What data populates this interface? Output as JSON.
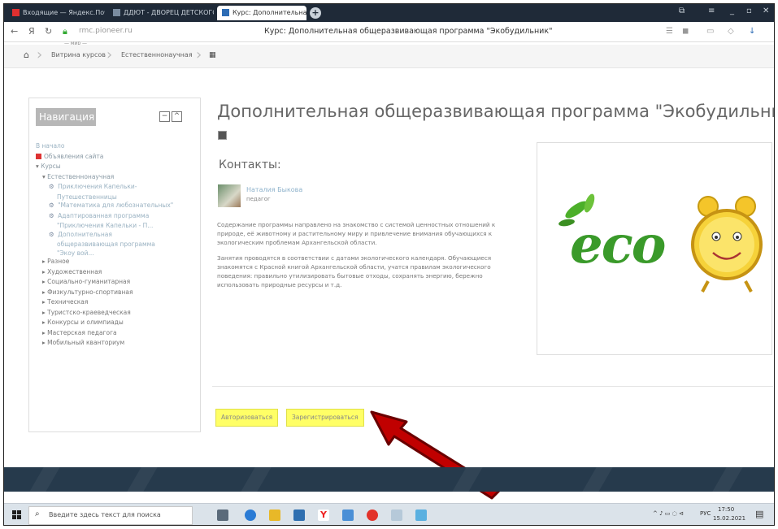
{
  "browser": {
    "tabs": [
      {
        "label": "Входящие — Яндекс.Почта",
        "active": false
      },
      {
        "label": "ДДЮТ - ДВОРЕЦ ДЕТСКОГО",
        "active": false
      },
      {
        "label": "Курс: Дополнительная",
        "active": true
      }
    ],
    "url": "rmc.pioneer.ru",
    "page_title": "Курс: Дополнительная общеразвивающая программа \"Экобудильник\"",
    "logo_fragment": "— мир —"
  },
  "breadcrumb": {
    "items": [
      "Витрина курсов",
      "Естественнонаучная"
    ]
  },
  "navigation": {
    "title": "Навигация",
    "items": [
      {
        "label": "В начало",
        "level": 0,
        "kind": "link"
      },
      {
        "label": "Объявления сайта",
        "level": 0,
        "kind": "forum"
      },
      {
        "label": "Курсы",
        "level": 0,
        "kind": "expanded"
      },
      {
        "label": "Естественнонаучная",
        "level": 1,
        "kind": "expanded"
      },
      {
        "label": "Приключения Капельки-",
        "level": 2,
        "kind": "course"
      },
      {
        "label": "Путешественницы",
        "level": 3,
        "kind": "text"
      },
      {
        "label": "\"Математика для любознательных\"",
        "level": 2,
        "kind": "course"
      },
      {
        "label": "Адаптированная программа",
        "level": 2,
        "kind": "course"
      },
      {
        "label": "\"Приключения Капельки - П...",
        "level": 3,
        "kind": "text"
      },
      {
        "label": "Дополнительная",
        "level": 2,
        "kind": "course"
      },
      {
        "label": "общеразвивающая программа",
        "level": 3,
        "kind": "text"
      },
      {
        "label": "\"Экоу вой...",
        "level": 3,
        "kind": "text"
      },
      {
        "label": "Разное",
        "level": 1,
        "kind": "collapsed"
      },
      {
        "label": "Художественная",
        "level": 1,
        "kind": "collapsed"
      },
      {
        "label": "Социально-гуманитарная",
        "level": 1,
        "kind": "collapsed"
      },
      {
        "label": "Физкультурно-спортивная",
        "level": 1,
        "kind": "collapsed"
      },
      {
        "label": "Техническая",
        "level": 1,
        "kind": "collapsed"
      },
      {
        "label": "Туристско-краеведческая",
        "level": 1,
        "kind": "collapsed"
      },
      {
        "label": "Конкурсы и олимпиады",
        "level": 1,
        "kind": "collapsed"
      },
      {
        "label": "Мастерская педагога",
        "level": 1,
        "kind": "collapsed"
      },
      {
        "label": "Мобильный кванториум",
        "level": 1,
        "kind": "collapsed"
      }
    ]
  },
  "course": {
    "title": "Дополнительная общеразвивающая программа \"Экобудильник\"",
    "contacts_heading": "Контакты:",
    "teacher_name": "Наталия Быкова",
    "teacher_role": "педагог",
    "paragraph1": "Содержание программы направлено на знакомство с системой ценностных отношений к природе, её животному и растительному миру и привлечение внимания обучающихся к экологическим проблемам Архангельской области.",
    "paragraph2": "Занятия проводятся в соответствии с датами экологического календаря. Обучающиеся знакомятся с Красной книгой Архангельской области, учатся правилам экологического поведения: правильно утилизировать бытовые отходы, сохранять энергию, бережно использовать природные ресурсы и т.д.",
    "image_text": "eco"
  },
  "actions": {
    "login": "Авторизоваться",
    "register": "Зарегистрироваться"
  },
  "taskbar": {
    "search_placeholder": "Введите здесь текст для поиска",
    "time": "17:50",
    "date": "15.02.2021",
    "lang": "РУС"
  },
  "colors": {
    "button_yellow": "#ffff66",
    "footer": "#263a4c",
    "arrow": "#c00000"
  }
}
